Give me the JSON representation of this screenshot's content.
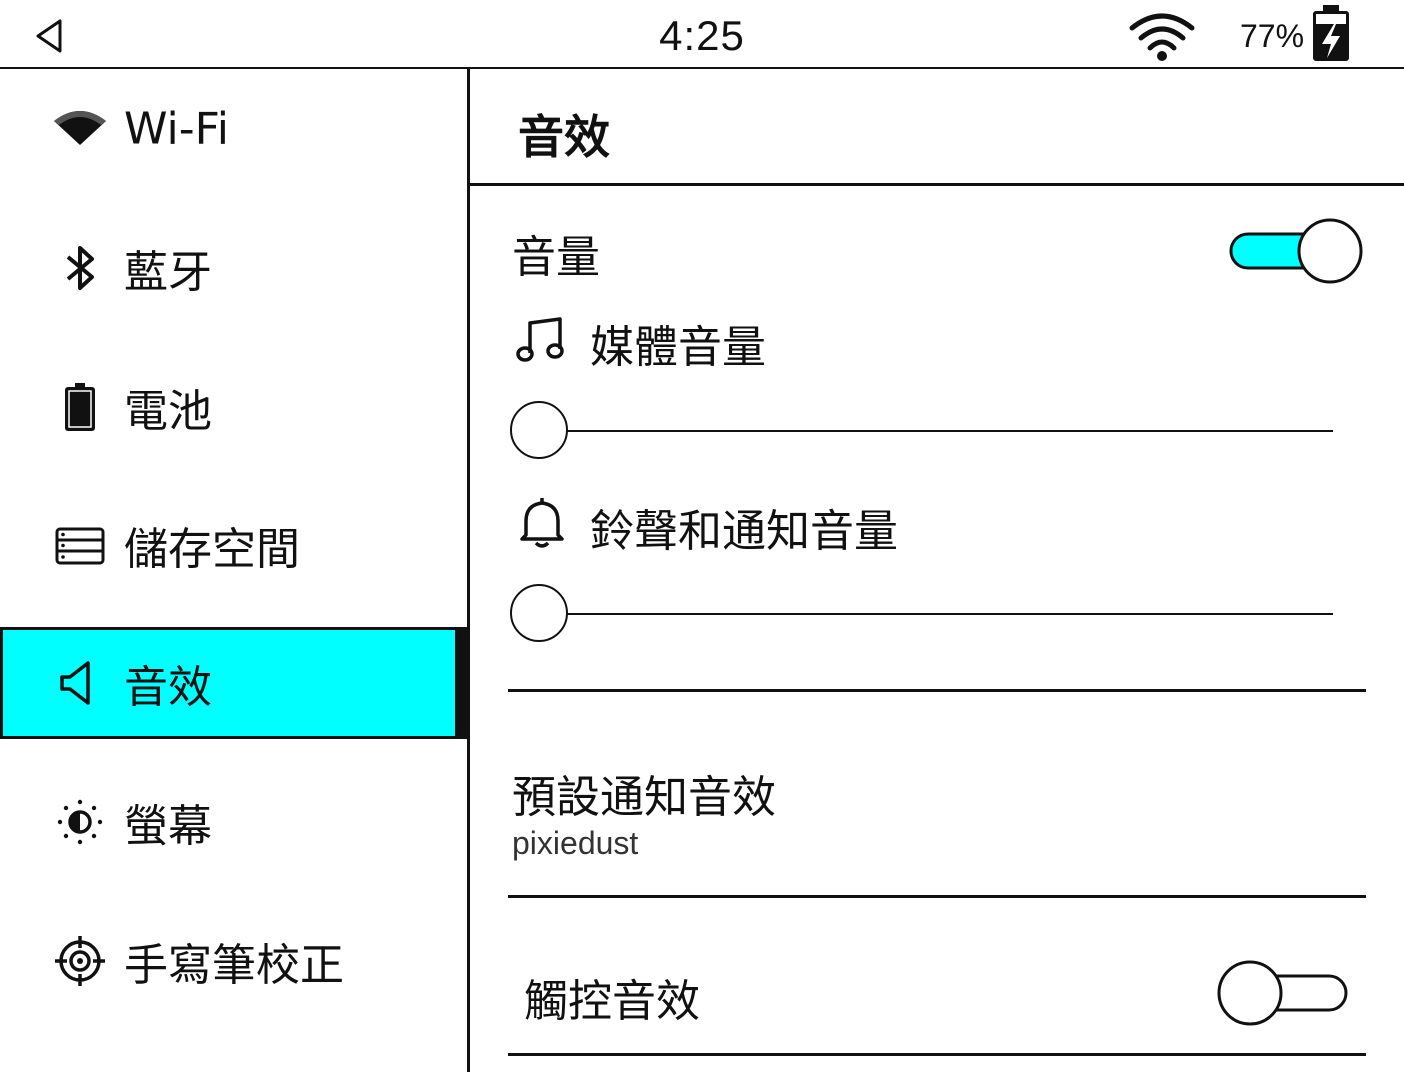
{
  "status_bar": {
    "time": "4:25",
    "battery_percent": "77%",
    "battery_charging": true,
    "icons": [
      "back-icon",
      "wifi-icon",
      "battery-charging-icon"
    ]
  },
  "sidebar": {
    "items": [
      {
        "label": "Wi-Fi",
        "icon": "wifi-icon",
        "active": false
      },
      {
        "label": "藍牙",
        "icon": "bluetooth-icon",
        "active": false
      },
      {
        "label": "電池",
        "icon": "battery-icon",
        "active": false
      },
      {
        "label": "儲存空間",
        "icon": "storage-icon",
        "active": false
      },
      {
        "label": "音效",
        "icon": "speaker-icon",
        "active": true
      },
      {
        "label": "螢幕",
        "icon": "brightness-icon",
        "active": false
      },
      {
        "label": "手寫筆校正",
        "icon": "crosshair-icon",
        "active": false
      }
    ],
    "active_color": "#00ffff"
  },
  "main": {
    "title": "音效",
    "volume": {
      "label": "音量",
      "toggle_on": true,
      "toggle_color": "#00ffff"
    },
    "media_volume": {
      "label": "媒體音量",
      "icon": "music-note-icon",
      "level": 0
    },
    "ring_volume": {
      "label": "鈴聲和通知音量",
      "icon": "bell-icon",
      "level": 0
    },
    "default_notification": {
      "label": "預設通知音效",
      "value": "pixiedust"
    },
    "touch_sounds": {
      "label": "觸控音效",
      "toggle_on": false
    }
  }
}
